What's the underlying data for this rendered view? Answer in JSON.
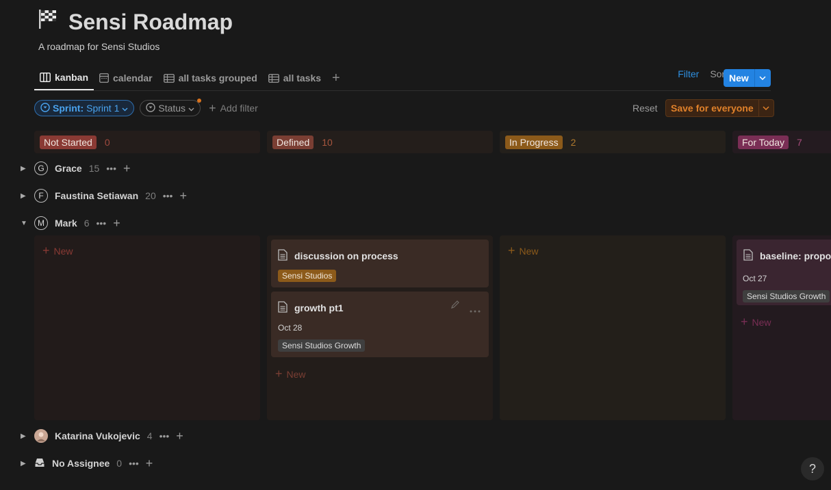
{
  "page": {
    "icon": "checkered-flag-icon",
    "title": "Sensi Roadmap",
    "subtitle": "A roadmap for Sensi Studios"
  },
  "tabs": [
    {
      "label": "kanban",
      "icon": "board-icon",
      "active": true
    },
    {
      "label": "calendar",
      "icon": "calendar-icon"
    },
    {
      "label": "all tasks grouped",
      "icon": "table-icon"
    },
    {
      "label": "all tasks",
      "icon": "table-icon"
    }
  ],
  "toolbar": {
    "filter": "Filter",
    "sort": "Sort",
    "new": "New"
  },
  "filters": {
    "sprint_key": "Sprint:",
    "sprint_value": "Sprint 1",
    "status": "Status",
    "add_filter": "Add filter",
    "reset": "Reset",
    "save": "Save for everyone"
  },
  "columns": [
    {
      "name": "Not Started",
      "count": "0",
      "color": "#8a3a34"
    },
    {
      "name": "Defined",
      "count": "10",
      "color": "#7a3e33"
    },
    {
      "name": "In Progress",
      "count": "2",
      "color": "#8c5a1a"
    },
    {
      "name": "For Today",
      "count": "7",
      "color": "#7a2e55"
    }
  ],
  "groups": [
    {
      "avatar": "G",
      "name": "Grace",
      "count": "15"
    },
    {
      "avatar": "F",
      "name": "Faustina Setiawan",
      "count": "20"
    },
    {
      "avatar": "M",
      "name": "Mark",
      "count": "6"
    },
    {
      "avatar": "",
      "name": "Katarina Vukojevic",
      "count": "4"
    },
    {
      "avatar": "",
      "name": "No Assignee",
      "count": "0"
    }
  ],
  "lane_new": "New",
  "cards": {
    "defined_1": {
      "title": "discussion on process",
      "tag": "Sensi Studios"
    },
    "defined_2": {
      "title": "growth pt1",
      "date": "Oct 28",
      "tag": "Sensi Studios Growth"
    },
    "today_1": {
      "title": "baseline: propos",
      "date": "Oct 27",
      "tag": "Sensi Studios Growth"
    }
  },
  "help": "?"
}
